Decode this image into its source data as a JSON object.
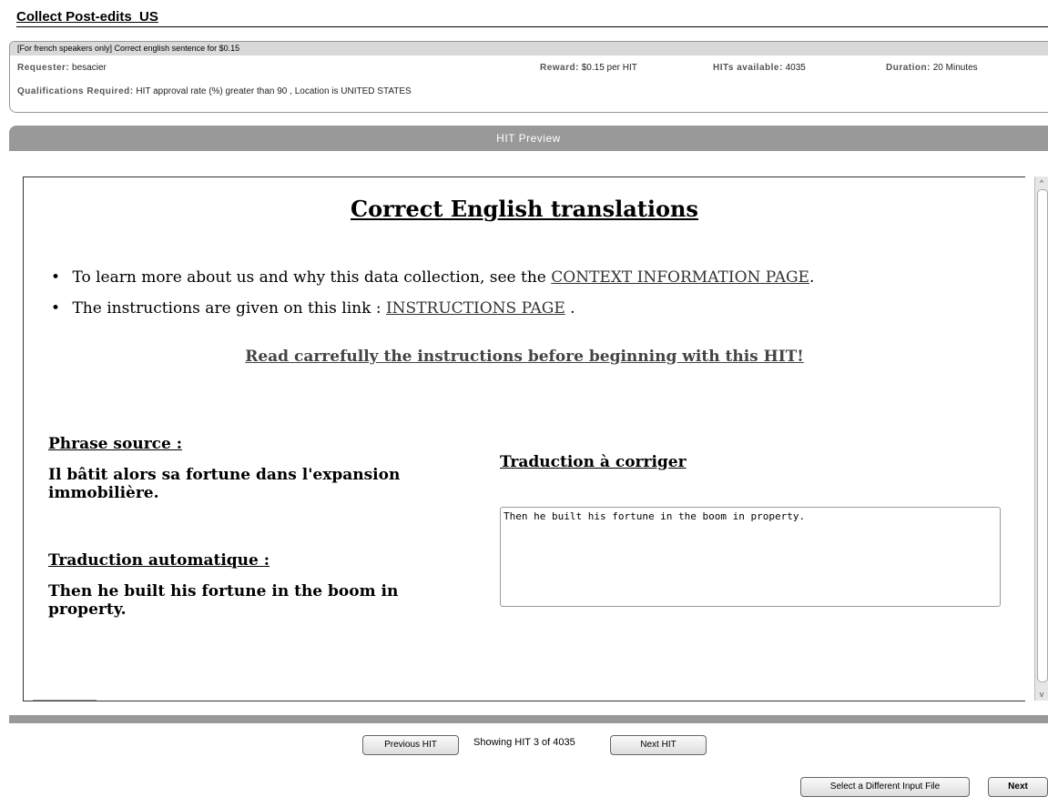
{
  "page": {
    "title": "Collect Post-edits_US"
  },
  "info": {
    "hit_title": "[For french speakers only] Correct english sentence for $0.15",
    "requester_label": "Requester:",
    "requester_value": "besacier",
    "reward_label": "Reward:",
    "reward_value": "$0.15 per HIT",
    "hits_label": "HITs available:",
    "hits_value": "4035",
    "duration_label": "Duration:",
    "duration_value": "20 Minutes",
    "qual_label": "Qualifications Required:",
    "qual_value": "HIT approval rate (%)  greater than  90 , Location  is  UNITED STATES"
  },
  "preview": {
    "bar_label": "HIT Preview",
    "heading": "Correct English translations",
    "bullet1_text": "To learn more about us and why this data collection, see the ",
    "bullet1_link": "CONTEXT INFORMATION PAGE",
    "bullet1_end": ".",
    "bullet2_text": "The instructions are given on this link : ",
    "bullet2_link": "INSTRUCTIONS PAGE",
    "bullet2_end": " .",
    "warning": "Read carrefully the instructions before beginning with this HIT!",
    "source_label": "Phrase source :",
    "source_text": "Il bâtit alors sa fortune dans l'expansion immobilière.",
    "auto_label": "Traduction automatique :",
    "auto_text": "Then he built his fortune in the boom in property.",
    "correct_label": "Traduction à corriger",
    "correct_value": "Then he built his fortune in the boom in property."
  },
  "nav": {
    "prev_label": "Previous HIT",
    "showing": "Showing HIT 3 of 4035",
    "next_label": "Next HIT",
    "select_file_label": "Select a Different Input File",
    "next_button_label": "Next"
  }
}
